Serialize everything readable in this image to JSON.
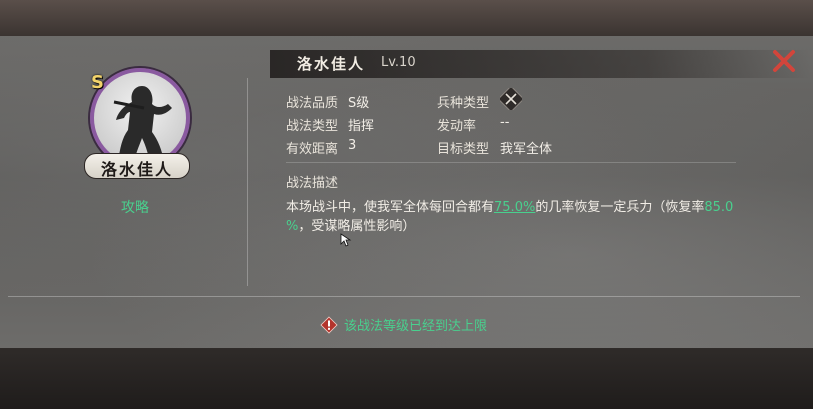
{
  "skill": {
    "name": "洛水佳人",
    "level": "Lv.10",
    "grade": "S"
  },
  "portrait": {
    "name_plate": "洛水佳人",
    "strategy_link": "攻略"
  },
  "attributes": [
    {
      "label": "战法品质",
      "value": "S级"
    },
    {
      "label": "兵种类型",
      "value": ""
    },
    {
      "label": "战法类型",
      "value": "指挥"
    },
    {
      "label": "发动率",
      "value": "--"
    },
    {
      "label": "有效距离",
      "value": "3"
    },
    {
      "label": "目标类型",
      "value": "我军全体"
    }
  ],
  "description": {
    "title": "战法描述",
    "part1": "本场战斗中，使我军全体每回合都有",
    "rate": "75.0%",
    "part2": "的几率恢复一定兵力（恢复率",
    "recover_rate_line1": "85.0",
    "recover_rate_line2": "%",
    "part3": "，受谋略属性影响）"
  },
  "footer": {
    "warning": "该战法等级已经到达上限"
  },
  "icons": {
    "close": "close-icon",
    "warning": "warning-icon",
    "troop_type": "crossed-swords-icon",
    "cursor": "mouse-cursor-icon"
  },
  "colors": {
    "accent_green": "#49d08e",
    "close_red": "#d2453b",
    "grade_gold": "#f2d36b",
    "portrait_ring": "#8a5aa0"
  }
}
